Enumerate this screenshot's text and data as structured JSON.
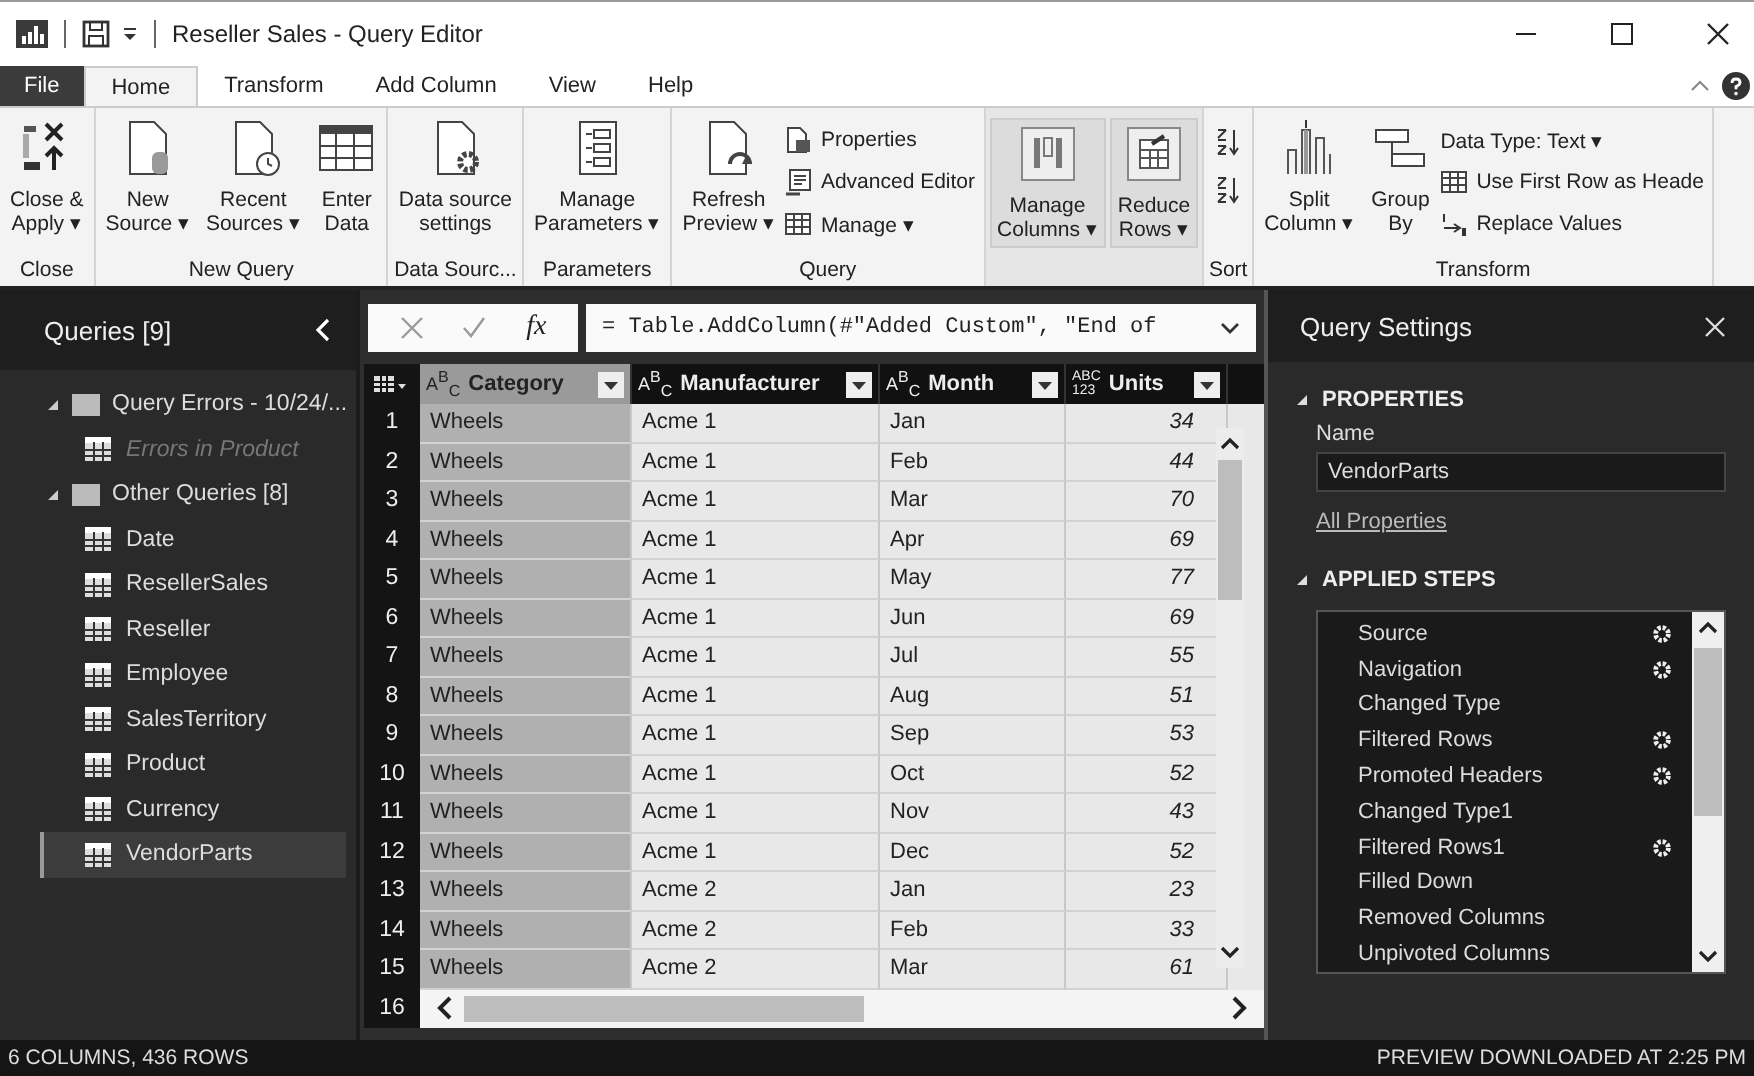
{
  "window": {
    "title": "Reseller Sales - Query Editor"
  },
  "ribbon_tabs": [
    {
      "label": "File",
      "kind": "menu",
      "selected": false
    },
    {
      "label": "Home",
      "kind": "tab",
      "selected": true
    },
    {
      "label": "Transform",
      "kind": "tab",
      "selected": false
    },
    {
      "label": "Add Column",
      "kind": "tab",
      "selected": false
    },
    {
      "label": "View",
      "kind": "tab",
      "selected": false
    },
    {
      "label": "Help",
      "kind": "tab",
      "selected": false
    }
  ],
  "ribbon_groups": [
    {
      "label": "Close",
      "shaded": false,
      "items": [
        {
          "kind": "large",
          "lines": [
            "Close &",
            "Apply ▾"
          ]
        }
      ]
    },
    {
      "label": "New Query",
      "shaded": false,
      "items": [
        {
          "kind": "large",
          "lines": [
            "New",
            "Source ▾"
          ]
        },
        {
          "kind": "large",
          "lines": [
            "Recent",
            "Sources ▾"
          ]
        },
        {
          "kind": "large",
          "lines": [
            "Enter",
            "Data"
          ]
        }
      ]
    },
    {
      "label": "Data Sourc...",
      "shaded": false,
      "items": [
        {
          "kind": "large",
          "lines": [
            "Data source",
            "settings"
          ]
        }
      ]
    },
    {
      "label": "Parameters",
      "shaded": false,
      "items": [
        {
          "kind": "large",
          "lines": [
            "Manage",
            "Parameters ▾"
          ]
        }
      ]
    },
    {
      "label": "Query",
      "shaded": false,
      "items": [
        {
          "kind": "large",
          "lines": [
            "Refresh",
            "Preview ▾"
          ]
        },
        {
          "kind": "small",
          "labels": [
            "Properties",
            "Advanced Editor",
            "Manage ▾"
          ]
        }
      ]
    },
    {
      "shaded": true,
      "items": [
        {
          "kind": "large",
          "lines": [
            "Manage",
            "Columns ▾"
          ]
        },
        {
          "kind": "large",
          "lines": [
            "Reduce",
            "Rows ▾"
          ]
        }
      ]
    },
    {
      "label": "Sort",
      "shaded": false,
      "items": [
        {
          "kind": "sort"
        }
      ]
    },
    {
      "label": "Transform",
      "shaded": false,
      "items": [
        {
          "kind": "large",
          "lines": [
            "Split",
            "Column ▾"
          ]
        },
        {
          "kind": "large",
          "lines": [
            "Group",
            "By"
          ]
        },
        {
          "kind": "small",
          "labels": [
            "Data Type: Text ▾",
            "Use First Row as Heade",
            "Replace Values"
          ]
        }
      ]
    }
  ],
  "queries": {
    "title": "Queries [9]",
    "groups": [
      {
        "label": "Query Errors - 10/24/...",
        "expanded": true,
        "children": [
          {
            "label": "Errors in Product",
            "disabled": true,
            "selected": false
          }
        ]
      },
      {
        "label": "Other Queries [8]",
        "expanded": true,
        "children": [
          {
            "label": "Date",
            "disabled": false,
            "selected": false
          },
          {
            "label": "ResellerSales",
            "disabled": false,
            "selected": false
          },
          {
            "label": "Reseller",
            "disabled": false,
            "selected": false
          },
          {
            "label": "Employee",
            "disabled": false,
            "selected": false
          },
          {
            "label": "SalesTerritory",
            "disabled": false,
            "selected": false
          },
          {
            "label": "Product",
            "disabled": false,
            "selected": false
          },
          {
            "label": "Currency",
            "disabled": false,
            "selected": false
          },
          {
            "label": "VendorParts",
            "disabled": false,
            "selected": true
          }
        ]
      }
    ]
  },
  "formula_bar": {
    "fx_label": "fx",
    "formula": "= Table.AddColumn(#\"Added Custom\", \"End of"
  },
  "table": {
    "columns": [
      {
        "name": "Category",
        "type_icon": "A$^{B}$$_{C}$",
        "selected": true
      },
      {
        "name": "Manufacturer",
        "type_icon": "A$^{B}$$_{C}$",
        "selected": false
      },
      {
        "name": "Month",
        "type_icon": "A$^{B}$$_{C}$",
        "selected": false
      },
      {
        "name": "Units",
        "type_icon": "$^{ABC}$$_{123}$",
        "selected": false
      }
    ],
    "rows": [
      {
        "number": "1",
        "cells": [
          "Wheels",
          "Acme 1",
          "Jan",
          "34"
        ]
      },
      {
        "number": "2",
        "cells": [
          "Wheels",
          "Acme 1",
          "Feb",
          "44"
        ]
      },
      {
        "number": "3",
        "cells": [
          "Wheels",
          "Acme 1",
          "Mar",
          "70"
        ]
      },
      {
        "number": "4",
        "cells": [
          "Wheels",
          "Acme 1",
          "Apr",
          "69"
        ]
      },
      {
        "number": "5",
        "cells": [
          "Wheels",
          "Acme 1",
          "May",
          "77"
        ]
      },
      {
        "number": "6",
        "cells": [
          "Wheels",
          "Acme 1",
          "Jun",
          "69"
        ]
      },
      {
        "number": "7",
        "cells": [
          "Wheels",
          "Acme 1",
          "Jul",
          "55"
        ]
      },
      {
        "number": "8",
        "cells": [
          "Wheels",
          "Acme 1",
          "Aug",
          "51"
        ]
      },
      {
        "number": "9",
        "cells": [
          "Wheels",
          "Acme 1",
          "Sep",
          "53"
        ]
      },
      {
        "number": "10",
        "cells": [
          "Wheels",
          "Acme 1",
          "Oct",
          "52"
        ]
      },
      {
        "number": "11",
        "cells": [
          "Wheels",
          "Acme 1",
          "Nov",
          "43"
        ]
      },
      {
        "number": "12",
        "cells": [
          "Wheels",
          "Acme 1",
          "Dec",
          "52"
        ]
      },
      {
        "number": "13",
        "cells": [
          "Wheels",
          "Acme 2",
          "Jan",
          "23"
        ]
      },
      {
        "number": "14",
        "cells": [
          "Wheels",
          "Acme 2",
          "Feb",
          "33"
        ]
      },
      {
        "number": "15",
        "cells": [
          "Wheels",
          "Acme 2",
          "Mar",
          "61"
        ]
      },
      {
        "number": "16"
      }
    ]
  },
  "query_settings": {
    "title": "Query Settings",
    "properties": {
      "heading": "PROPERTIES",
      "expanded": true,
      "name_label": "Name",
      "name_value": "VendorParts",
      "link": "All Properties"
    },
    "applied_steps": {
      "heading": "APPLIED STEPS",
      "expanded": true,
      "steps": [
        {
          "label": "Source",
          "has_settings": true
        },
        {
          "label": "Navigation",
          "has_settings": true
        },
        {
          "label": "Changed Type",
          "has_settings": false
        },
        {
          "label": "Filtered Rows",
          "has_settings": true
        },
        {
          "label": "Promoted Headers",
          "has_settings": true
        },
        {
          "label": "Changed Type1",
          "has_settings": false
        },
        {
          "label": "Filtered Rows1",
          "has_settings": true
        },
        {
          "label": "Filled Down",
          "has_settings": false
        },
        {
          "label": "Removed Columns",
          "has_settings": false
        },
        {
          "label": "Unpivoted Columns",
          "has_settings": false
        }
      ]
    }
  },
  "status_bar": {
    "left": "6 COLUMNS, 436 ROWS",
    "right": "PREVIEW DOWNLOADED AT 2:25 PM"
  }
}
